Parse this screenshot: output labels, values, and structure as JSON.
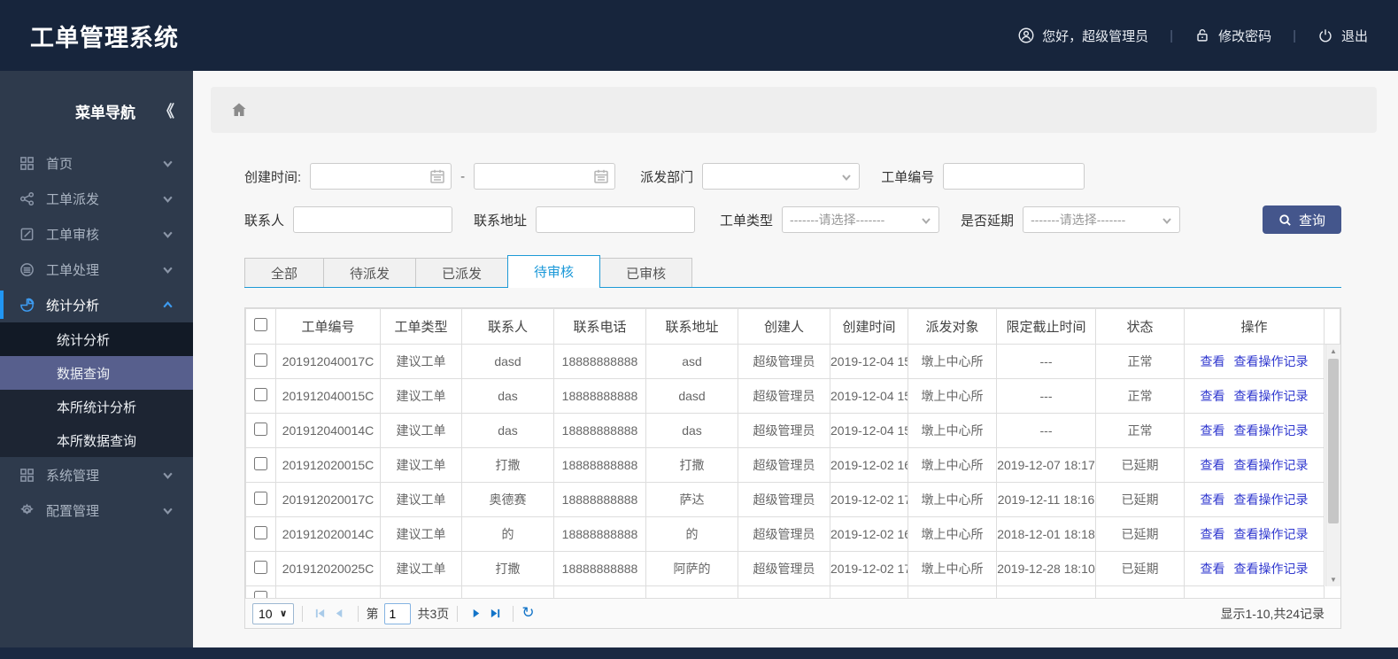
{
  "header": {
    "title": "工单管理系统",
    "greeting": "您好，超级管理员",
    "change_password": "修改密码",
    "logout": "退出"
  },
  "sidebar": {
    "title": "菜单导航",
    "collapse_icon": "《",
    "items": [
      {
        "label": "首页",
        "icon": "grid-icon"
      },
      {
        "label": "工单派发",
        "icon": "share-icon"
      },
      {
        "label": "工单审核",
        "icon": "edit-icon"
      },
      {
        "label": "工单处理",
        "icon": "database-icon"
      },
      {
        "label": "统计分析",
        "icon": "pie-chart-icon",
        "children": [
          "统计分析",
          "数据查询",
          "本所统计分析",
          "本所数据查询"
        ],
        "selected_child": "数据查询"
      },
      {
        "label": "系统管理",
        "icon": "grid-icon"
      },
      {
        "label": "配置管理",
        "icon": "gear-icon"
      }
    ]
  },
  "filters": {
    "created_time_label": "创建时间:",
    "date_separator": "-",
    "dispatch_dept_label": "派发部门",
    "order_no_label": "工单编号",
    "contact_label": "联系人",
    "address_label": "联系地址",
    "order_type_label": "工单类型",
    "order_type_value": "-------请选择-------",
    "delay_label": "是否延期",
    "delay_value": "-------请选择-------",
    "search_button": "查询"
  },
  "tabs": [
    {
      "label": "全部"
    },
    {
      "label": "待派发"
    },
    {
      "label": "已派发"
    },
    {
      "label": "待审核",
      "active": true
    },
    {
      "label": "已审核"
    }
  ],
  "table": {
    "columns": [
      "工单编号",
      "工单类型",
      "联系人",
      "联系电话",
      "联系地址",
      "创建人",
      "创建时间",
      "派发对象",
      "限定截止时间",
      "状态",
      "操作"
    ],
    "action_links": [
      "查看",
      "查看操作记录"
    ],
    "rows": [
      {
        "id": "201912040017C",
        "type": "建议工单",
        "contact": "dasd",
        "phone": "18888888888",
        "address": "asd",
        "creator": "超级管理员",
        "created": "2019-12-04 15",
        "target": "墩上中心所",
        "deadline": "---",
        "status": "正常",
        "status_type": "normal"
      },
      {
        "id": "201912040015C",
        "type": "建议工单",
        "contact": "das",
        "phone": "18888888888",
        "address": "dasd",
        "creator": "超级管理员",
        "created": "2019-12-04 15",
        "target": "墩上中心所",
        "deadline": "---",
        "status": "正常",
        "status_type": "normal"
      },
      {
        "id": "201912040014C",
        "type": "建议工单",
        "contact": "das",
        "phone": "18888888888",
        "address": "das",
        "creator": "超级管理员",
        "created": "2019-12-04 15",
        "target": "墩上中心所",
        "deadline": "---",
        "status": "正常",
        "status_type": "normal"
      },
      {
        "id": "201912020015C",
        "type": "建议工单",
        "contact": "打撒",
        "phone": "18888888888",
        "address": "打撒",
        "creator": "超级管理员",
        "created": "2019-12-02 16",
        "target": "墩上中心所",
        "deadline": "2019-12-07 18:17",
        "status": "已延期",
        "status_type": "delayed"
      },
      {
        "id": "201912020017C",
        "type": "建议工单",
        "contact": "奥德赛",
        "phone": "18888888888",
        "address": "萨达",
        "creator": "超级管理员",
        "created": "2019-12-02 17",
        "target": "墩上中心所",
        "deadline": "2019-12-11 18:16",
        "status": "已延期",
        "status_type": "delayed"
      },
      {
        "id": "201912020014C",
        "type": "建议工单",
        "contact": "的",
        "phone": "18888888888",
        "address": "的",
        "creator": "超级管理员",
        "created": "2019-12-02 16",
        "target": "墩上中心所",
        "deadline": "2018-12-01 18:18",
        "status": "已延期",
        "status_type": "delayed"
      },
      {
        "id": "201912020025C",
        "type": "建议工单",
        "contact": "打撒",
        "phone": "18888888888",
        "address": "阿萨的",
        "creator": "超级管理员",
        "created": "2019-12-02 17",
        "target": "墩上中心所",
        "deadline": "2019-12-28 18:10",
        "status": "已延期",
        "status_type": "delayed"
      }
    ]
  },
  "pagination": {
    "page_size": "10",
    "page_prefix": "第",
    "current_page": "1",
    "total_pages": "共3页",
    "summary": "显示1-10,共24记录"
  },
  "colors": {
    "header_bg": "#17253c",
    "sidebar_bg": "#2e3a4c",
    "accent_blue": "#2196f3",
    "tab_blue": "#1d9ad6",
    "status_normal": "#2b3fc0",
    "status_delayed": "#e02222",
    "link_blue": "#3038cf",
    "button_bg": "#44568c"
  }
}
